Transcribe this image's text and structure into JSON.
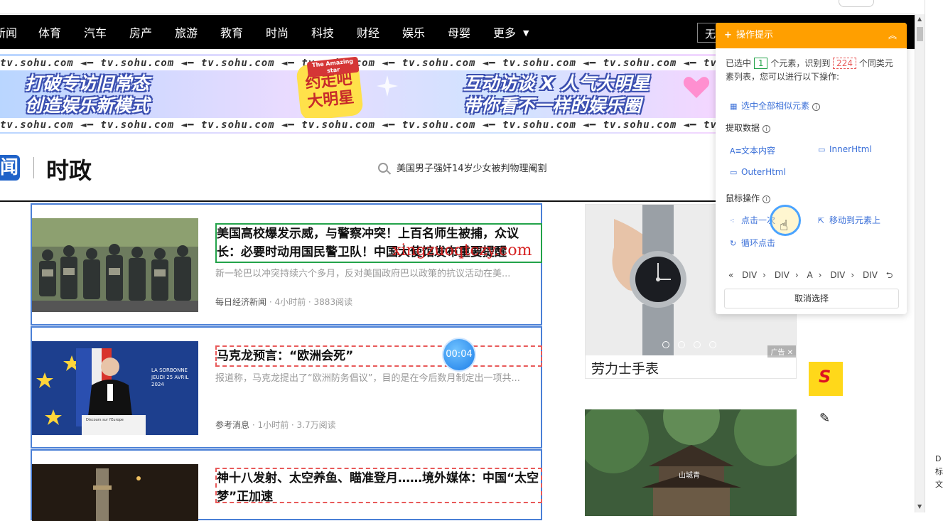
{
  "nav": {
    "items": [
      "新闻",
      "体育",
      "汽车",
      "房产",
      "旅游",
      "教育",
      "时尚",
      "科技",
      "财经",
      "娱乐",
      "母婴",
      "更多"
    ],
    "more_caret": "▼",
    "search_prefix": "无"
  },
  "banner": {
    "strip_text": "tv.sohu.com  ◄━  tv.sohu.com  ◄━  tv.sohu.com  ◄━  tv.sohu.com  ◄━  tv.sohu.com  ◄━  tv.sohu.com  ◄━  tv.sohu.com  ◄━  tv.sohu.com",
    "left_line1": "打破专访旧常态",
    "left_line2": "创造娱乐新模式",
    "right_line1": "互动访谈 X 人气大明星",
    "right_line2": "带你看不一样的娱乐圈",
    "logo_tag": "The Amazing star",
    "logo_line1": "约走吧",
    "logo_line2": "大明星"
  },
  "section": {
    "logo_char": "闻",
    "title": "时政",
    "search_hint": "美国男子强奸14岁少女被判物理阉割"
  },
  "cards": [
    {
      "title": "美国高校爆发示威，与警察冲突！上百名师生被捕，众议长：必要时动用国民警卫队！中国大使馆发布重要提醒",
      "summary": "新一轮巴以冲突持续六个多月，反对美国政府巴以政策的抗议活动在美...",
      "source": "每日经济新闻",
      "meta": " · 4小时前 · 3883阅读"
    },
    {
      "title": "马克龙预言：“欧洲会死”",
      "summary": "报道称，马克龙提出了“欧洲防务倡议”，目的是在今后数月制定出一项共...",
      "source": "参考消息",
      "meta": " · 1小时前 · 3.7万阅读",
      "image_caption_1": "LA SORBONNE",
      "image_caption_2": "JEUDI 25 AVRIL 2024",
      "podium_text": "Discours sur l'Europe"
    },
    {
      "title": "神十八发射、太空养鱼、瞄准登月……境外媒体：中国“太空梦”正加速"
    }
  ],
  "watermark": "xingzuoqtczy.com",
  "timer": "00:04",
  "ads": {
    "ad1_caption": "劳力士手表",
    "ad1_tag": "广告",
    "ad2_sign": "山城青"
  },
  "panel": {
    "title": "操作提示",
    "collapse_icon": "chevron-up-icon",
    "info_pre": "已选中",
    "selected_count": "1",
    "info_mid": "个元素，识别到",
    "similar_count": "224",
    "info_post": "个同类元素列表，您可以进行以下操作:",
    "select_all": "选中全部相似元素",
    "extract_label": "提取数据",
    "text_content": "文本内容",
    "inner_html": "InnerHtml",
    "outer_html": "OuterHtml",
    "mouse_label": "鼠标操作",
    "click_once": "点击一次",
    "move_to": "移动到元素上",
    "loop_click": "循环点击",
    "crumbs": [
      "DIV",
      "DIV",
      "A",
      "DIV",
      "DIV"
    ],
    "cancel": "取消选择"
  },
  "colors": {
    "panel_header": "#ff9f00",
    "accent_blue": "#3a6fd8",
    "selected_green": "#23a34a",
    "similar_red": "#e85a5a"
  },
  "edge_text": [
    "D",
    "标",
    "文"
  ]
}
